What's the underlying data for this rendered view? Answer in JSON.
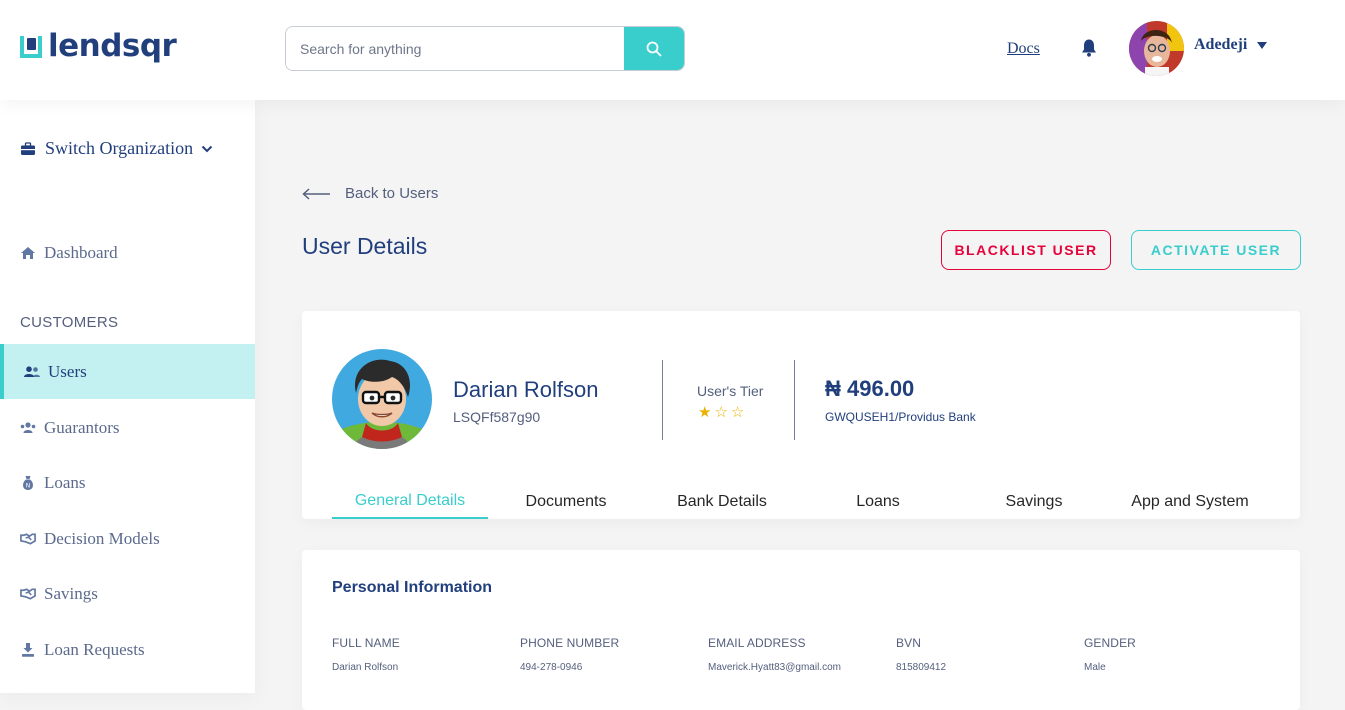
{
  "header": {
    "logo_text": "lendsqr",
    "search_placeholder": "Search for anything",
    "docs_label": "Docs",
    "user_name": "Adedeji"
  },
  "sidebar": {
    "switch_org_label": "Switch Organization",
    "dashboard_label": "Dashboard",
    "section_customers": "CUSTOMERS",
    "items": [
      {
        "label": "Users",
        "icon": "users-icon",
        "active": true
      },
      {
        "label": "Guarantors",
        "icon": "guarantors-icon",
        "active": false
      },
      {
        "label": "Loans",
        "icon": "loans-sack-icon",
        "active": false
      },
      {
        "label": "Decision Models",
        "icon": "handshake-icon",
        "active": false
      },
      {
        "label": "Savings",
        "icon": "savings-icon",
        "active": false
      },
      {
        "label": "Loan Requests",
        "icon": "loan-requests-icon",
        "active": false
      }
    ]
  },
  "main": {
    "back_label": "Back to Users",
    "page_title": "User Details",
    "blacklist_label": "BLACKLIST USER",
    "activate_label": "ACTIVATE USER"
  },
  "profile": {
    "name": "Darian Rolfson",
    "id": "LSQFf587g90",
    "tier_label": "User's Tier",
    "tier_stars": "★☆☆",
    "tier_rating": 1,
    "tier_max": 3,
    "balance": "₦ 496.00",
    "bank": "GWQUSEH1/Providus Bank",
    "tabs": [
      "General Details",
      "Documents",
      "Bank Details",
      "Loans",
      "Savings",
      "App and System"
    ],
    "active_tab": "General Details"
  },
  "personal_info": {
    "title": "Personal Information",
    "fields": [
      {
        "key": "FULL NAME",
        "value": "Darian Rolfson"
      },
      {
        "key": "PHONE NUMBER",
        "value": "494-278-0946"
      },
      {
        "key": "EMAIL ADDRESS",
        "value": "Maverick.Hyatt83@gmail.com"
      },
      {
        "key": "BVN",
        "value": "815809412"
      },
      {
        "key": "GENDER",
        "value": "Male"
      }
    ]
  },
  "colors": {
    "brand_navy": "#213f7d",
    "brand_teal": "#39cdcc",
    "danger": "#e4033b",
    "star": "#e9b200"
  }
}
